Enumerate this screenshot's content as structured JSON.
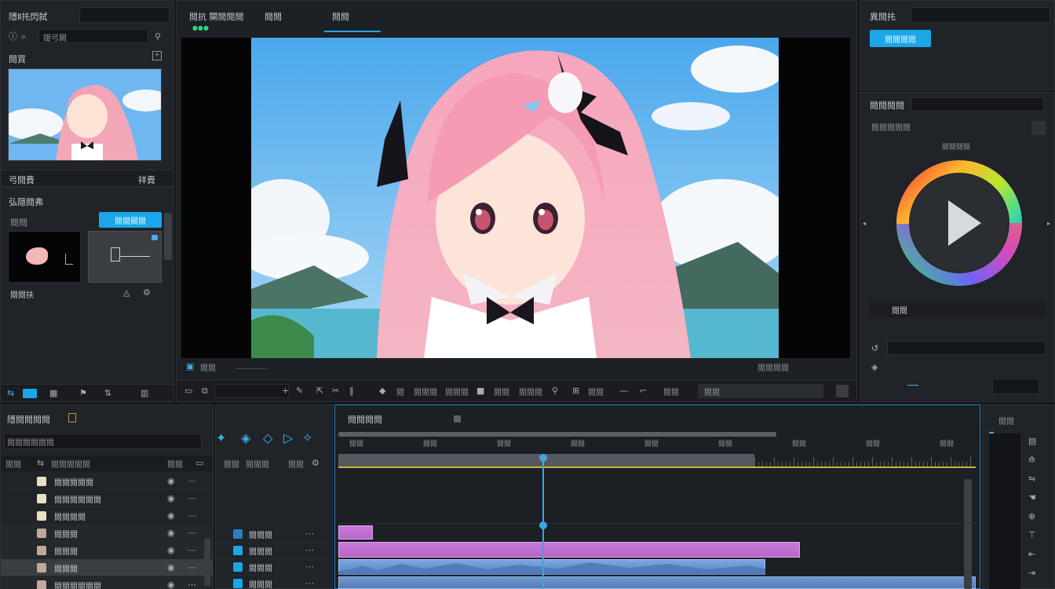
{
  "colors": {
    "accent": "#1aa6e8",
    "clip_video": "#c77ad9",
    "clip_audio": "#6f9ad6",
    "playhead": "#3aa7e0",
    "timecode_green": "#36d07a"
  },
  "left_panel": {
    "title": "隱Ⅱ扥閃弑",
    "search_placeholder": "閾弓闋",
    "preview_label": "閱買",
    "clip_name": "弓閱費",
    "clip_count": "祥費",
    "effects_title": "弘隠閱弗",
    "effects_tab": "閱閱",
    "effects_active_tab": "閱閱闋閱",
    "effects_footer": "閱閱扶",
    "icons": [
      "info-icon",
      "search-icon",
      "expand-icon",
      "plus-icon",
      "settings-icon"
    ]
  },
  "viewer": {
    "tabs": [
      "閱抗 闋閱閱閱",
      "閱閱",
      "閱閱"
    ],
    "timecode": "●●●",
    "status_label": "閱閱",
    "zoom_label": "閱閱閱閱",
    "toolbar": [
      "閱",
      "閱閱閱",
      "閱閱閱",
      "閱",
      "閱閱",
      "閱閱閱",
      "閱閱",
      "閱閱",
      "閱閱"
    ]
  },
  "right_panel": {
    "title": "異閱扥",
    "apply_button": "閱閱閱閱",
    "section_title": "閱閱閱閱",
    "subsection": "閱閱閱閱閱",
    "wheel_label": "閱閱閱閱",
    "value_label": "閱閱"
  },
  "media_panel": {
    "title": "隱閱閱閱閱",
    "breadcrumb": "閱閱閱閱閱閱",
    "columns": [
      "閱閱",
      "閱閱閱閱閱",
      "閱閱"
    ],
    "items": [
      {
        "name": "閱閱閱閱閱",
        "type": "image"
      },
      {
        "name": "閱閱閱閱閱閱",
        "type": "image"
      },
      {
        "name": "閱閱閱閱",
        "type": "image"
      },
      {
        "name": "閱閱閱",
        "type": "audio"
      },
      {
        "name": "閱閱閱",
        "type": "audio"
      },
      {
        "name": "閱閱閱",
        "type": "audio"
      },
      {
        "name": "閱閱閱閱閱閱",
        "type": "audio"
      }
    ]
  },
  "track_headers": {
    "columns": [
      "閱閱",
      "閱閱閱",
      "閱閱"
    ],
    "tracks": [
      "閱閱閱",
      "閱閱閱",
      "閱閱閱",
      "閱閱閱"
    ]
  },
  "timeline": {
    "title": "閱閱閱閱",
    "ruler_labels": [
      "閱閱",
      "閱閱",
      "閱閱",
      "閱閱",
      "閱閱",
      "閱閱",
      "閱閱",
      "閱閱",
      "閱閱"
    ],
    "playhead_position_pct": 20.5
  },
  "tools_panel": {
    "title": "閱閱"
  }
}
